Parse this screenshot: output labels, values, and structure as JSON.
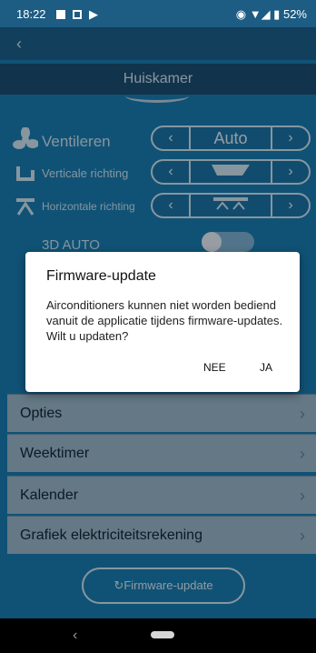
{
  "status": {
    "time": "18:22",
    "battery": "52%"
  },
  "header": {
    "room": "Huiskamer"
  },
  "settings": {
    "fan": {
      "label": "Ventileren",
      "value": "Auto"
    },
    "vertical": {
      "label": "Verticale richting"
    },
    "horizontal": {
      "label": "Horizontale richting"
    },
    "auto3d": {
      "label": "3D AUTO"
    }
  },
  "menu": [
    {
      "label": "Opties"
    },
    {
      "label": "Weektimer"
    },
    {
      "label": "Kalender"
    },
    {
      "label": "Grafiek elektriciteitsrekening"
    }
  ],
  "firmware_button": "Firmware-update",
  "dialog": {
    "title": "Firmware-update",
    "message": "Airconditioners kunnen niet worden bediend vanuit de applicatie tijdens firmware-updates. Wilt u updaten?",
    "cancel": "NEE",
    "confirm": "JA"
  },
  "colors": {
    "accent": "#1a7fb4",
    "header": "#1b4f74"
  }
}
